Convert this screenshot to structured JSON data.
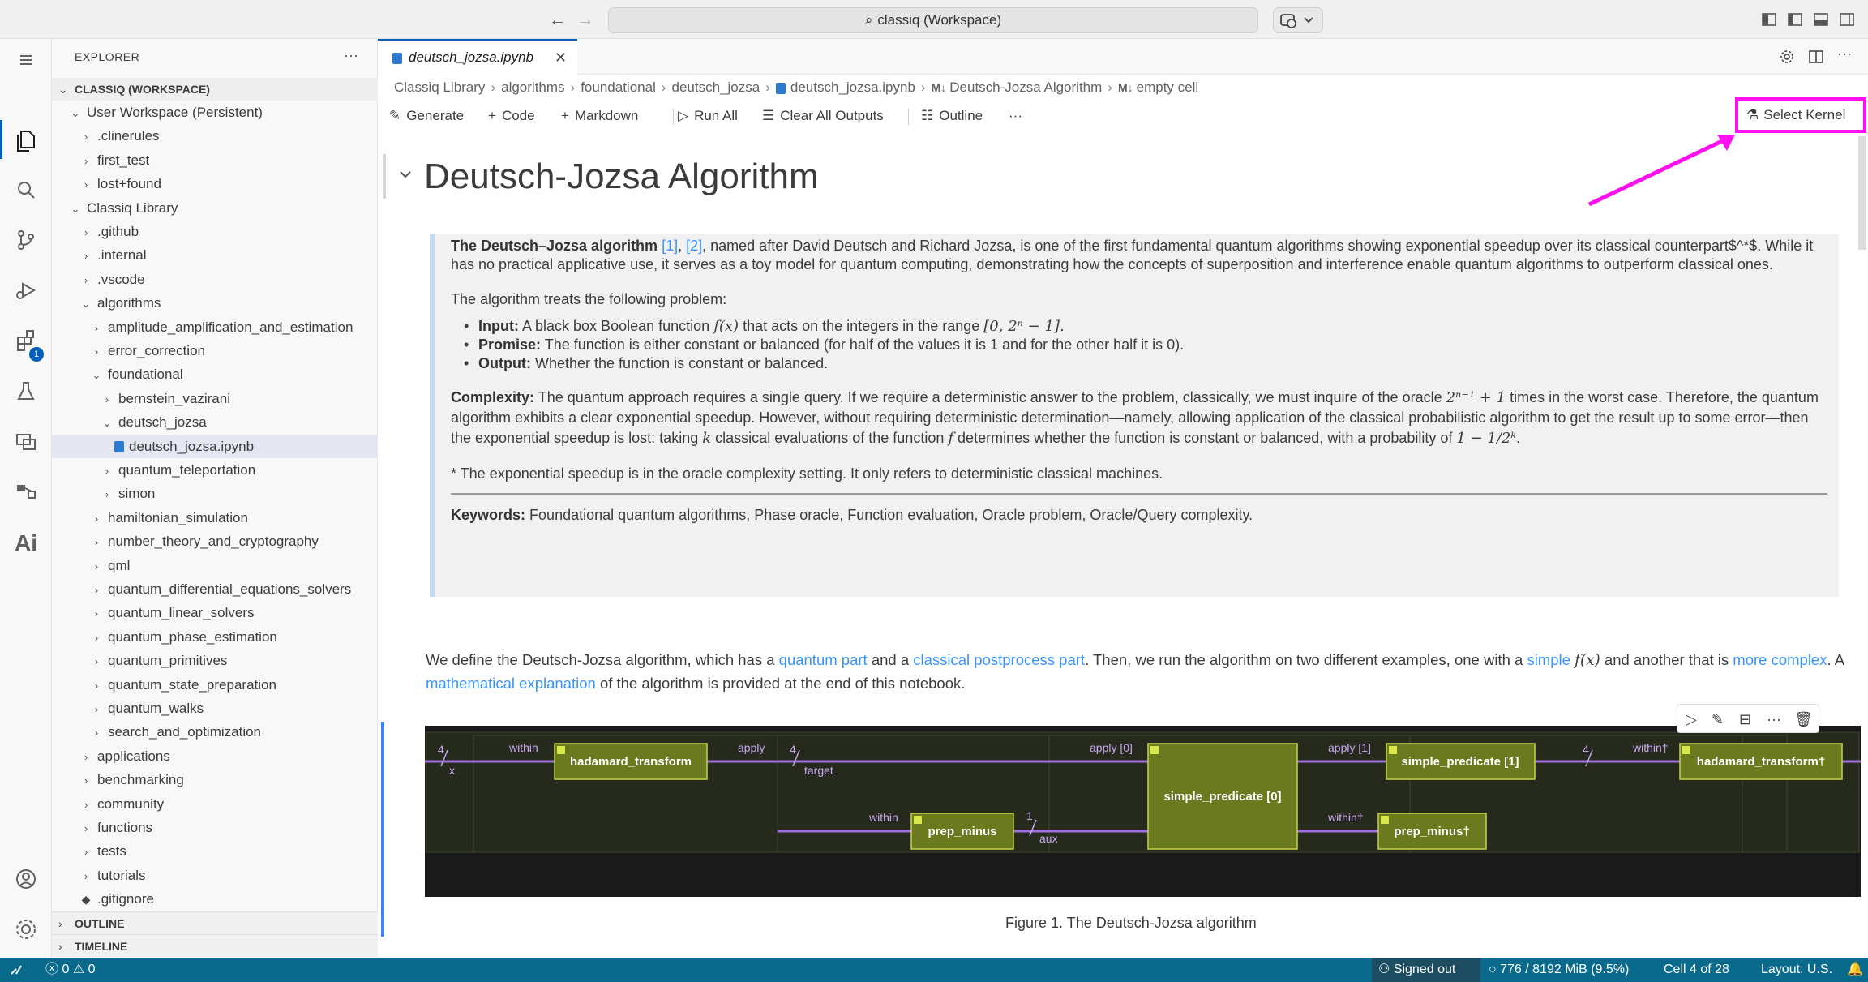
{
  "titlebar": {
    "command_center": "classiq (Workspace)"
  },
  "sidebar": {
    "header": "EXPLORER",
    "workspace_section": "CLASSIQ (WORKSPACE)",
    "tree": [
      {
        "label": "User Workspace (Persistent)",
        "indent": 1,
        "state": "open"
      },
      {
        "label": ".clinerules",
        "indent": 2,
        "state": "closed"
      },
      {
        "label": "first_test",
        "indent": 2,
        "state": "closed"
      },
      {
        "label": "lost+found",
        "indent": 2,
        "state": "closed"
      },
      {
        "label": "Classiq Library",
        "indent": 1,
        "state": "open"
      },
      {
        "label": ".github",
        "indent": 2,
        "state": "closed"
      },
      {
        "label": ".internal",
        "indent": 2,
        "state": "closed"
      },
      {
        "label": ".vscode",
        "indent": 2,
        "state": "closed"
      },
      {
        "label": "algorithms",
        "indent": 2,
        "state": "open"
      },
      {
        "label": "amplitude_amplification_and_estimation",
        "indent": 3,
        "state": "closed"
      },
      {
        "label": "error_correction",
        "indent": 3,
        "state": "closed"
      },
      {
        "label": "foundational",
        "indent": 3,
        "state": "open"
      },
      {
        "label": "bernstein_vazirani",
        "indent": 4,
        "state": "closed"
      },
      {
        "label": "deutsch_jozsa",
        "indent": 4,
        "state": "open"
      },
      {
        "label": "deutsch_jozsa.ipynb",
        "indent": 5,
        "state": "file",
        "selected": true
      },
      {
        "label": "quantum_teleportation",
        "indent": 4,
        "state": "closed"
      },
      {
        "label": "simon",
        "indent": 4,
        "state": "closed"
      },
      {
        "label": "hamiltonian_simulation",
        "indent": 3,
        "state": "closed"
      },
      {
        "label": "number_theory_and_cryptography",
        "indent": 3,
        "state": "closed"
      },
      {
        "label": "qml",
        "indent": 3,
        "state": "closed"
      },
      {
        "label": "quantum_differential_equations_solvers",
        "indent": 3,
        "state": "closed"
      },
      {
        "label": "quantum_linear_solvers",
        "indent": 3,
        "state": "closed"
      },
      {
        "label": "quantum_phase_estimation",
        "indent": 3,
        "state": "closed"
      },
      {
        "label": "quantum_primitives",
        "indent": 3,
        "state": "closed"
      },
      {
        "label": "quantum_state_preparation",
        "indent": 3,
        "state": "closed"
      },
      {
        "label": "quantum_walks",
        "indent": 3,
        "state": "closed"
      },
      {
        "label": "search_and_optimization",
        "indent": 3,
        "state": "closed"
      },
      {
        "label": "applications",
        "indent": 2,
        "state": "closed"
      },
      {
        "label": "benchmarking",
        "indent": 2,
        "state": "closed"
      },
      {
        "label": "community",
        "indent": 2,
        "state": "closed"
      },
      {
        "label": "functions",
        "indent": 2,
        "state": "closed"
      },
      {
        "label": "tests",
        "indent": 2,
        "state": "closed"
      },
      {
        "label": "tutorials",
        "indent": 2,
        "state": "closed"
      },
      {
        "label": ".gitignore",
        "indent": 2,
        "state": "git"
      }
    ],
    "outline_section": "OUTLINE",
    "timeline_section": "TIMELINE"
  },
  "activity": {
    "extensions_badge": "1"
  },
  "tab": {
    "label": "deutsch_jozsa.ipynb",
    "close": "✕"
  },
  "breadcrumb": [
    "Classiq Library",
    "algorithms",
    "foundational",
    "deutsch_jozsa",
    "deutsch_jozsa.ipynb",
    "Deutsch-Jozsa Algorithm",
    "empty cell"
  ],
  "toolbar": {
    "generate": "Generate",
    "code": "Code",
    "markdown": "Markdown",
    "run_all": "Run All",
    "clear_outputs": "Clear All Outputs",
    "outline": "Outline",
    "more": "···",
    "select_kernel": "Select Kernel"
  },
  "notebook": {
    "heading": "Deutsch-Jozsa Algorithm",
    "intro_bold": "The Deutsch–Jozsa algorithm",
    "ref1": "[1]",
    "ref_sep": ",",
    "ref2": "[2]",
    "intro_rest": ", named after David Deutsch and Richard Jozsa, is one of the first fundamental quantum algorithms showing exponential speedup over its classical counterpart$^*$. While it has no practical applicative use, it serves as a toy model for quantum computing, demonstrating how the concepts of superposition and interference enable quantum algorithms to outperform classical ones.",
    "problem_intro": "The algorithm treats the following problem:",
    "input_label": "Input:",
    "input_text_a": "A black box Boolean function",
    "input_math1": "f(x)",
    "input_text_b": "that acts on the integers in the range",
    "input_math2": "[0, 2ⁿ − 1].",
    "promise_label": "Promise:",
    "promise_text": "The function is either constant or balanced (for half of the values it is 1 and for the other half it is 0).",
    "output_label": "Output:",
    "output_text": "Whether the function is constant or balanced.",
    "complexity_label": "Complexity:",
    "complexity_a": "The quantum approach requires a single query. If we require a deterministic answer to the problem, classically, we must inquire of the oracle",
    "complexity_math1": "2ⁿ⁻¹ + 1",
    "complexity_b": "times in the worst case. Therefore, the quantum algorithm exhibits a clear exponential speedup. However, without requiring deterministic determination—namely, allowing application of the classical probabilistic algorithm to get the result up to some error—then the exponential speedup is lost: taking",
    "complexity_math2": "k",
    "complexity_c": "classical evaluations of the function",
    "complexity_math3": "f",
    "complexity_d": "determines whether the function is constant or balanced, with a probability of",
    "complexity_math4": "1 − 1/2ᵏ",
    "complexity_e": ".",
    "footnote": "* The exponential speedup is in the oracle complexity setting. It only refers to deterministic classical machines.",
    "keywords_label": "Keywords:",
    "keywords": "Foundational quantum algorithms, Phase oracle, Function evaluation, Oracle problem, Oracle/Query complexity.",
    "p2_a": "We define the Deutsch-Jozsa algorithm, which has a",
    "p2_link1": "quantum part",
    "p2_b": "and a",
    "p2_link2": "classical postprocess part",
    "p2_c": ". Then, we run the algorithm on two different examples, one with a",
    "p2_link3": "simple",
    "p2_math": "f(x)",
    "p2_d": "and another that is",
    "p2_link4": "more complex",
    "p2_e": ". A",
    "p2_link5": "mathematical explanation",
    "p2_f": "of the algorithm is provided at the end of this notebook.",
    "caption": "Figure 1. The Deutsch-Jozsa algorithm"
  },
  "circuit": {
    "n4_a": "4",
    "x": "x",
    "within1": "within",
    "hadamard": "hadamard_transform",
    "apply": "apply",
    "n4_b": "4",
    "target": "target",
    "within2": "within",
    "prep_minus": "prep_minus",
    "one": "1",
    "aux": "aux",
    "apply0": "apply [0]",
    "simple_predicate0": "simple_predicate [0]",
    "apply1": "apply [1]",
    "simple_predicate1": "simple_predicate [1]",
    "within_dag": "within†",
    "prep_minus_dag": "prep_minus†",
    "n4_c": "4",
    "within_dag2": "within†",
    "hadamard_dag": "hadamard_transform†"
  },
  "statusbar": {
    "problems": "0",
    "warnings": "0",
    "signed_out": "Signed out",
    "memory": "776 / 8192 MiB (9.5%)",
    "cell": "Cell 4 of 28",
    "layout": "Layout: U.S."
  },
  "colors": {
    "accent": "#005fb8",
    "link": "#3794ff",
    "highlight": "#ff10f0",
    "statusbar": "#0a6a8c",
    "circuit_box": "#6b7a1f",
    "circuit_wire": "#a070e0"
  }
}
